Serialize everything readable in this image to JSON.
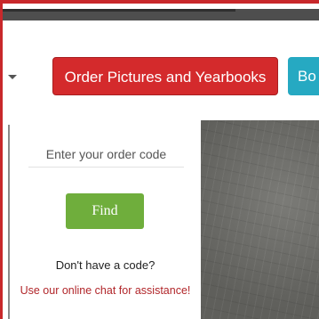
{
  "nav": {
    "order_button_label": "Order Pictures and Yearbooks",
    "book_button_label": "Bo"
  },
  "order_form": {
    "placeholder": "Enter your order code",
    "find_label": "Find",
    "no_code_text": "Don't have a code?",
    "chat_link_text": "Use our online chat for assistance!"
  },
  "icons": {
    "dropdown": "chevron-down-icon"
  },
  "colors": {
    "brand_red": "#d42a2c",
    "accent_teal": "#26a9c2",
    "find_green": "#6fae3c",
    "link_red": "#b1262a"
  }
}
